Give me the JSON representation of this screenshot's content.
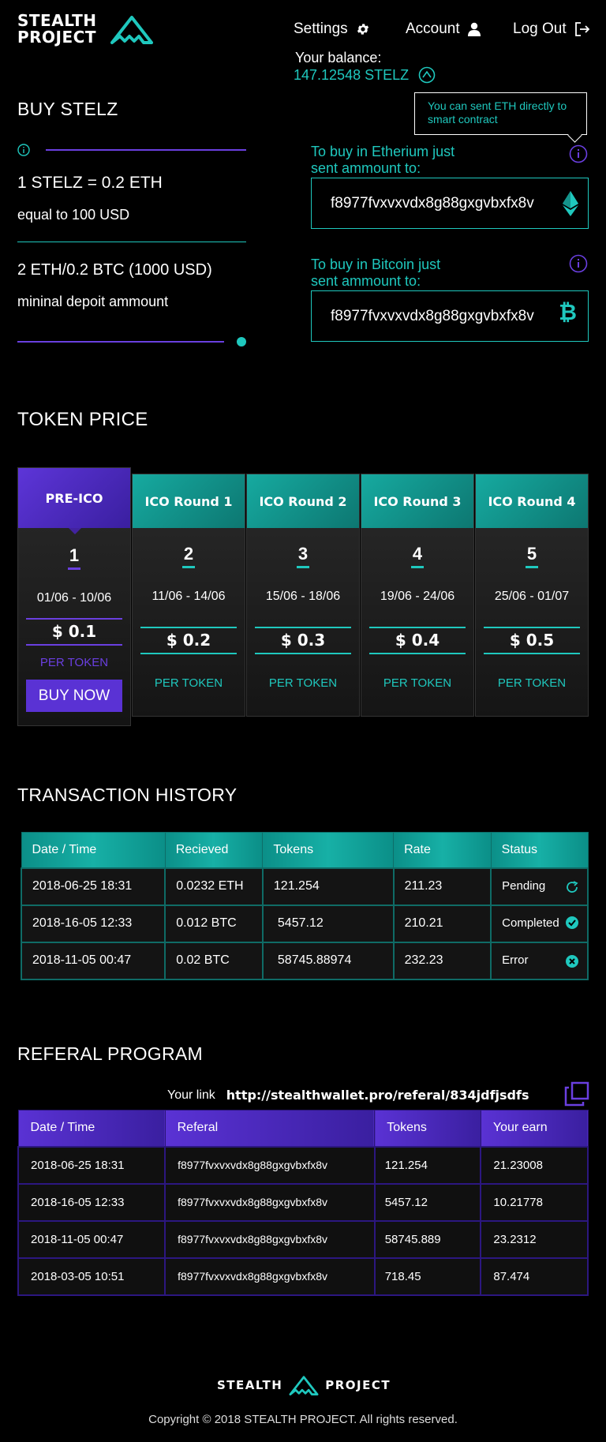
{
  "brand": {
    "line1": "STEALTH",
    "line2": "PROJECT"
  },
  "nav": {
    "settings": "Settings",
    "account": "Account",
    "logout": "Log Out"
  },
  "balance": {
    "label": "Your balance:",
    "value": "147.12548 STELZ"
  },
  "buy": {
    "title": "BUY STELZ",
    "rate": "1  STELZ = 0.2 ETH",
    "rate_usd": "equal to 100 USD",
    "min": "2 ETH/0.2 BTC (1000 USD)",
    "min_label": "mininal depoit ammount",
    "tooltip": "You can sent ETH directly to smart contract",
    "eth_label_1": "To buy in Etherium just",
    "eth_label_2": "sent ammount to:",
    "eth_address": "f8977fvxvxvdx8g88gxgvbxfx8v",
    "btc_label_1": "To buy in Bitcoin just",
    "btc_label_2": "sent ammount to:",
    "btc_address": "f8977fvxvxvdx8g88gxgvbxfx8v"
  },
  "token_price": {
    "title": "TOKEN PRICE",
    "rounds": [
      {
        "name": "PRE-ICO",
        "num": "1",
        "dates": "01/06 - 10/06",
        "price": "$ 0.1",
        "per": "PER TOKEN",
        "button": "BUY NOW"
      },
      {
        "name": "ICO Round 1",
        "num": "2",
        "dates": "11/06 - 14/06",
        "price": "$ 0.2",
        "per": "PER TOKEN"
      },
      {
        "name": "ICO Round 2",
        "num": "3",
        "dates": "15/06 - 18/06",
        "price": "$ 0.3",
        "per": "PER TOKEN"
      },
      {
        "name": "ICO Round 3",
        "num": "4",
        "dates": "19/06 - 24/06",
        "price": "$ 0.4",
        "per": "PER TOKEN"
      },
      {
        "name": "ICO Round 4",
        "num": "5",
        "dates": "25/06 - 01/07",
        "price": "$ 0.5",
        "per": "PER TOKEN"
      }
    ]
  },
  "transactions": {
    "title": "TRANSACTION HISTORY",
    "headers": [
      "Date / Time",
      "Recieved",
      "Tokens",
      "Rate",
      "Status"
    ],
    "rows": [
      [
        "2018-06-25 18:31",
        "0.0232 ETH",
        "121.254",
        "211.23",
        "Pending"
      ],
      [
        "2018-16-05 12:33",
        "0.012 BTC",
        "5457.12",
        "210.21",
        "Completed"
      ],
      [
        "2018-11-05 00:47",
        "0.02 BTC",
        "58745.88974",
        "232.23",
        "Error"
      ]
    ],
    "status_icons": [
      "refresh-icon",
      "check-icon",
      "error-icon"
    ]
  },
  "referral": {
    "title": "REFERAL PROGRAM",
    "link_label": "Your link",
    "link": "http://stealthwallet.pro/referal/834jdfjsdfs",
    "headers": [
      "Date / Time",
      "Referal",
      "Tokens",
      "Your earn"
    ],
    "rows": [
      [
        "2018-06-25 18:31",
        "f8977fvxvxvdx8g88gxgvbxfx8v",
        "121.254",
        "21.23008"
      ],
      [
        "2018-16-05 12:33",
        "f8977fvxvxvdx8g88gxgvbxfx8v",
        "5457.12",
        "10.21778"
      ],
      [
        "2018-11-05 00:47",
        "f8977fvxvxvdx8g88gxgvbxfx8v",
        "58745.889",
        "23.2312"
      ],
      [
        "2018-03-05 10:51",
        "f8977fvxvxvdx8g88gxgvbxfx8v",
        "718.45",
        "87.474"
      ]
    ]
  },
  "footer": {
    "left": "STEALTH",
    "right": "PROJECT",
    "copyright": "Copyright © 2018 STEALTH PROJECT. All rights reserved."
  },
  "colors": {
    "teal": "#1fc8be",
    "purple": "#6a3fe0",
    "background": "#000000"
  }
}
